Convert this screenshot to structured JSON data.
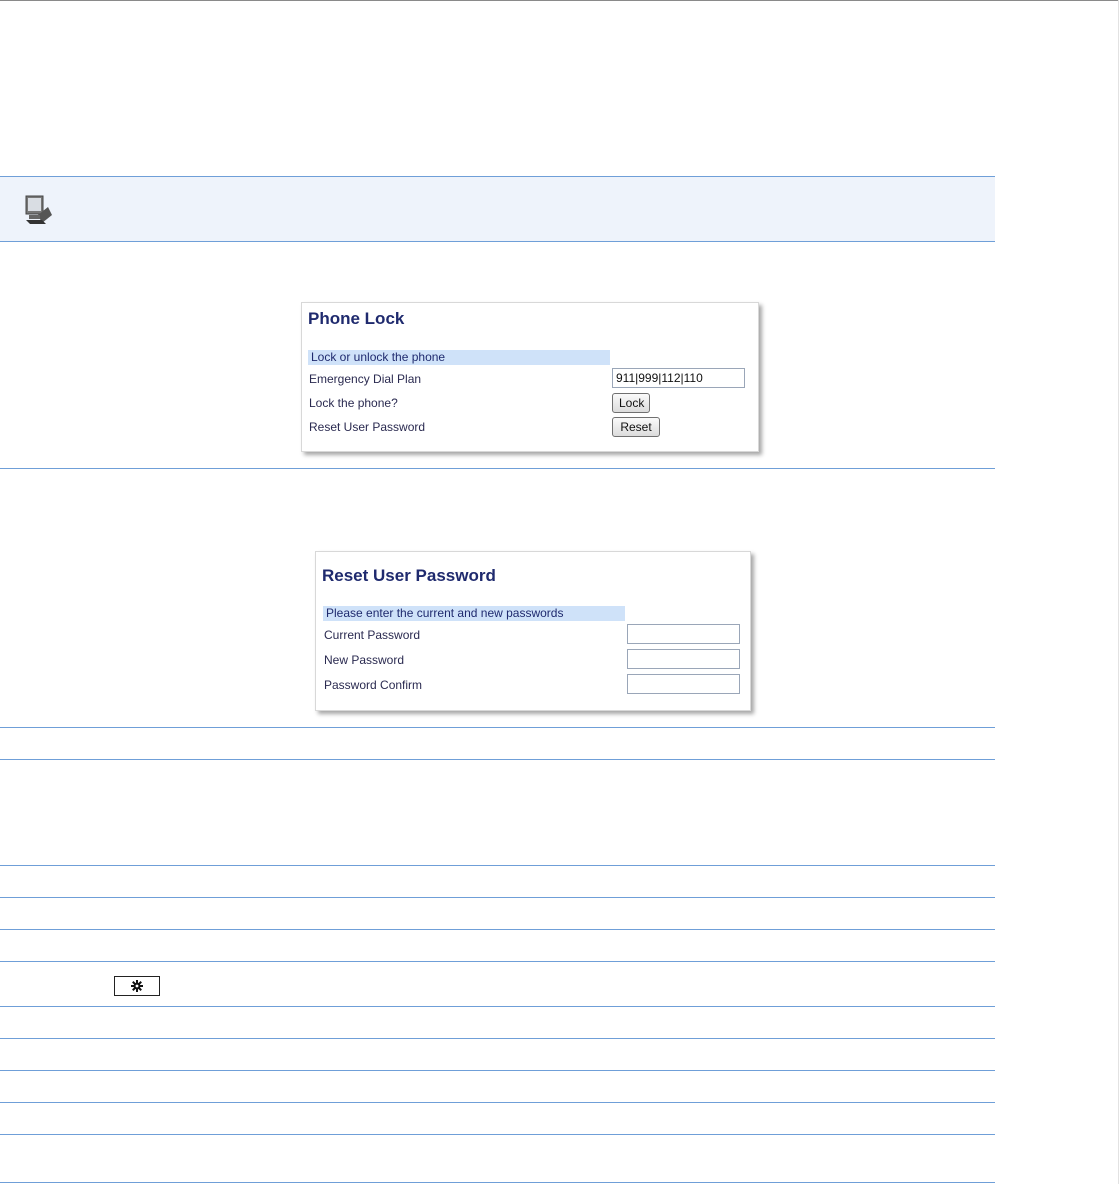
{
  "phone_lock": {
    "title": "Phone Lock",
    "section": "Lock or unlock the phone",
    "rows": [
      {
        "label": "Emergency Dial Plan",
        "value": "911|999|112|110"
      },
      {
        "label": "Lock the phone?",
        "button": "Lock"
      },
      {
        "label": "Reset User Password",
        "button": "Reset"
      }
    ]
  },
  "reset_password": {
    "title": "Reset User Password",
    "section": "Please enter the current and new passwords",
    "rows": [
      {
        "label": "Current Password",
        "value": ""
      },
      {
        "label": "New Password",
        "value": ""
      },
      {
        "label": "Password Confirm",
        "value": ""
      }
    ]
  },
  "icons": {
    "band_icon": "computer-icon",
    "key_icon": "gear-icon"
  },
  "colors": {
    "rule": "#6f9fd8",
    "heading": "#1f2a6e",
    "section_bar": "#cfe2f9"
  }
}
